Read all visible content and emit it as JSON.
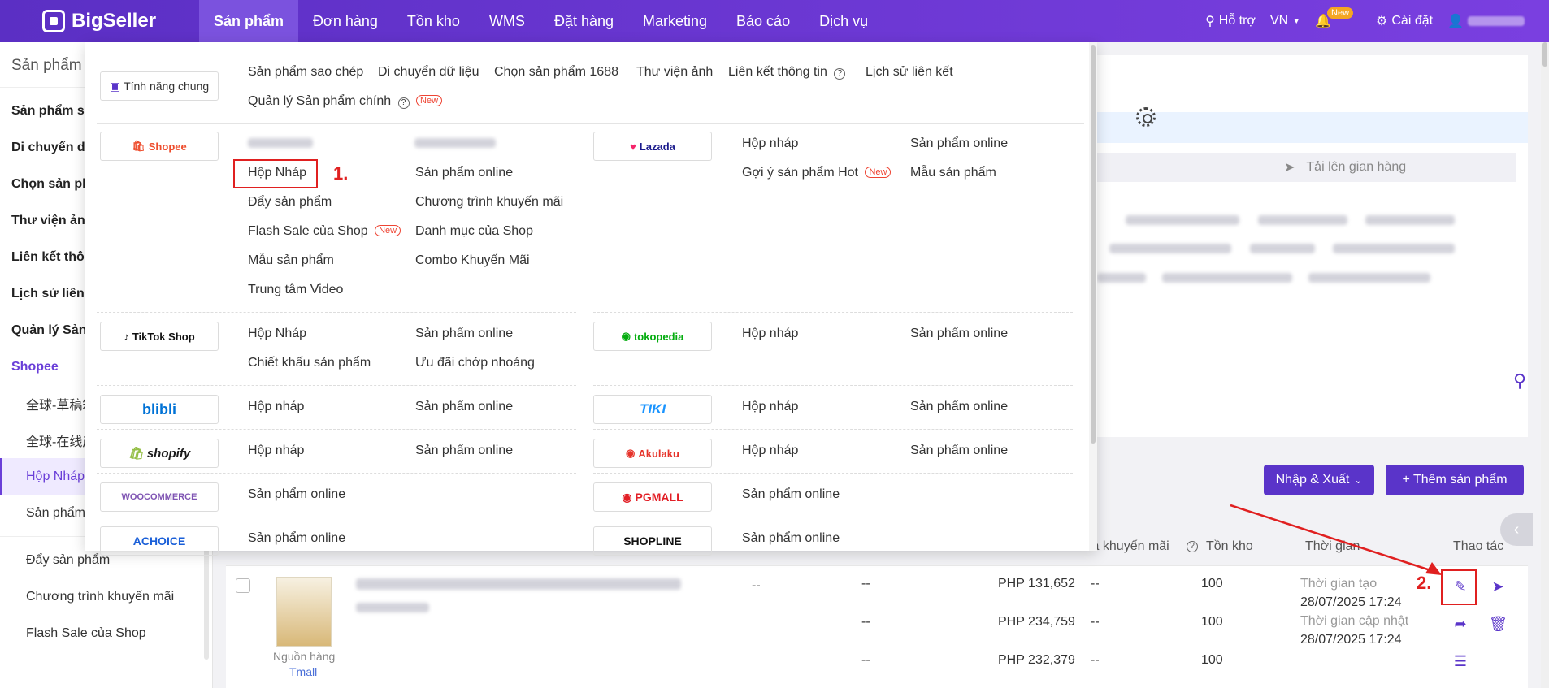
{
  "app": {
    "name": "BigSeller"
  },
  "nav": [
    {
      "label": "Sản phẩm"
    },
    {
      "label": "Đơn hàng"
    },
    {
      "label": "Tồn kho"
    },
    {
      "label": "WMS"
    },
    {
      "label": "Đặt hàng"
    },
    {
      "label": "Marketing"
    },
    {
      "label": "Báo cáo"
    },
    {
      "label": "Dịch vụ"
    }
  ],
  "topright": {
    "support": "Hỗ trợ",
    "lang": "VN",
    "new_badge": "New",
    "settings": "Cài đặt"
  },
  "sidebar": {
    "title": "Sản phẩm",
    "items": [
      "Sản phẩm sa",
      "Di chuyển dữ",
      "Chọn sản phẩ",
      "Thư viện ảnh",
      "Liên kết thôn",
      "Lịch sử liên k",
      "Quản lý Sản p"
    ],
    "platform": "Shopee",
    "subs": [
      "全球-草稿箱",
      "全球-在线产",
      "Hộp Nháp",
      "Sản phẩm",
      "Đẩy sản phẩm",
      "Chương trình khuyến mãi",
      "Flash Sale của Shop"
    ]
  },
  "dropdown": {
    "general_chip": "Tính năng chung",
    "general_links": [
      "Sản phẩm sao chép",
      "Di chuyển dữ liệu",
      "Chọn sản phẩm 1688",
      "Thư viện ảnh",
      "Liên kết thông tin",
      "Lịch sử liên kết"
    ],
    "general_link2": "Quản lý Sản phẩm chính",
    "new_tag": "New",
    "shopee": {
      "chip": "Shopee",
      "blur1": "全球-草稿箱",
      "blur2": "全球-在线产品",
      "col1": [
        "Hộp Nháp",
        "Đẩy sản phẩm",
        "Flash Sale của Shop",
        "Mẫu sản phẩm",
        "Trung tâm Video"
      ],
      "col2": [
        "Sản phẩm online",
        "Chương trình khuyến mãi",
        "Danh mục của Shop",
        "Combo Khuyến Mãi"
      ]
    },
    "lazada": {
      "chip": "Lazada",
      "col1": [
        "Hộp nháp",
        "Gợi ý sản phẩm Hot"
      ],
      "col2": [
        "Sản phẩm online",
        "Mẫu sản phẩm"
      ]
    },
    "tiktok": {
      "chip": "TikTok Shop",
      "col1": [
        "Hộp Nháp",
        "Chiết khấu sản phẩm"
      ],
      "col2": [
        "Sản phẩm online",
        "Ưu đãi chớp nhoáng"
      ]
    },
    "tokopedia": {
      "chip": "tokopedia",
      "col1": "Hộp nháp",
      "col2": "Sản phẩm online"
    },
    "blibli": {
      "chip": "blibli",
      "col1": "Hộp nháp",
      "col2": "Sản phẩm online"
    },
    "tiki": {
      "chip": "TIKI",
      "col1": "Hộp nháp",
      "col2": "Sản phẩm online"
    },
    "shopify": {
      "chip": "shopify",
      "col1": "Hộp nháp",
      "col2": "Sản phẩm online"
    },
    "akulaku": {
      "chip": "Akulaku",
      "col1": "Hộp nháp",
      "col2": "Sản phẩm online"
    },
    "woo": {
      "chip": "WOOCOMMERCE",
      "col1": "Sản phẩm online"
    },
    "pgmall": {
      "chip": "PGMALL",
      "col1": "Sản phẩm online"
    },
    "achoice": {
      "chip": "ACHOICE",
      "col1": "Sản phẩm online"
    },
    "shopline": {
      "chip": "SHOPLINE",
      "col1": "Sản phẩm online"
    }
  },
  "annotations": {
    "step1": "1.",
    "step2": "2."
  },
  "page": {
    "step_label": "Tải lên gian hàng",
    "import_export": "Nhập & Xuất",
    "add_product": "+ Thêm sản phẩm",
    "col_promo": "iá khuyến mãi",
    "col_stock": "Tồn kho",
    "col_time": "Thời gian",
    "col_action": "Thao tác",
    "source_label": "Nguồn hàng",
    "source_value": "Tmall",
    "rows": [
      {
        "dash1": "--",
        "price": "PHP 131,652",
        "dash2": "--",
        "stock": "100"
      },
      {
        "dash1": "--",
        "price": "PHP 234,759",
        "dash2": "--",
        "stock": "100"
      },
      {
        "dash1": "--",
        "price": "PHP 232,379",
        "dash2": "--",
        "stock": "100"
      }
    ],
    "dash_left": "--",
    "created_label": "Thời gian tạo",
    "created_value": "28/07/2025 17:24",
    "updated_label": "Thời gian cập nhật",
    "updated_value": "28/07/2025 17:24"
  }
}
